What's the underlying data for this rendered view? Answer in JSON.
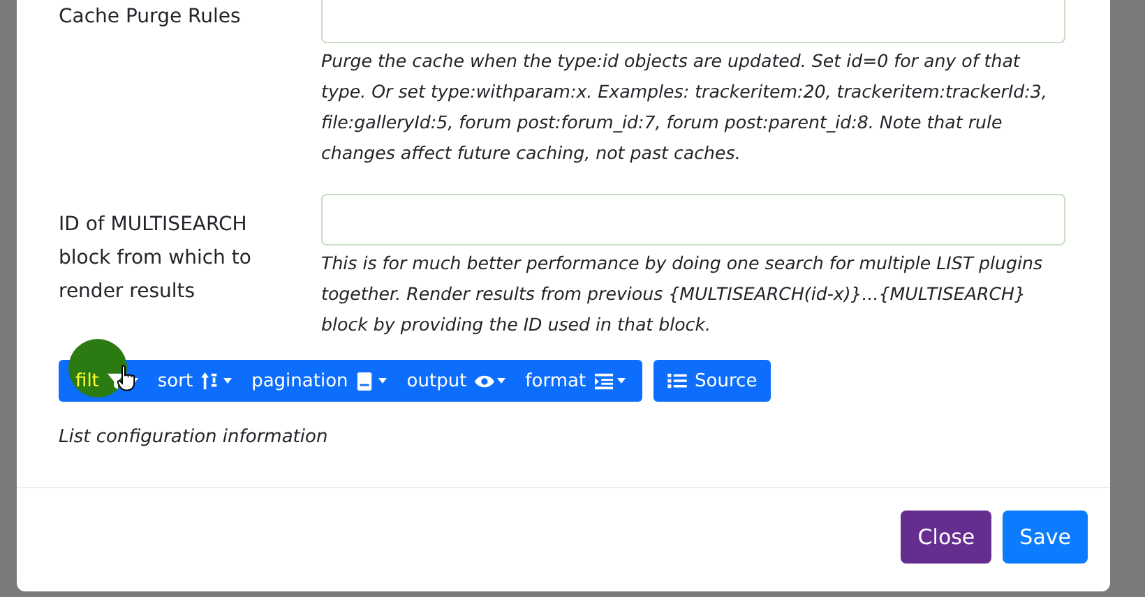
{
  "fields": [
    {
      "label": "Cache Purge Rules",
      "help": "Purge the cache when the type:id objects are updated. Set id=0 for any of that type. Or set type:withparam:x. Examples: trackeritem:20, trackeritem:trackerId:3, file:galleryId:5, forum post:forum_id:7, forum post:parent_id:8. Note that rule changes affect future caching, not past caches."
    },
    {
      "label": "ID of MULTISEARCH block from which to render results",
      "help": "This is for much better performance by doing one search for multiple LIST plugins together. Render results from previous {MULTISEARCH(id-x)}...{MULTISEARCH} block by providing the ID used in that block."
    }
  ],
  "toolbar": [
    {
      "label": "filt"
    },
    {
      "label": "sort"
    },
    {
      "label": "pagination"
    },
    {
      "label": "output"
    },
    {
      "label": "format"
    }
  ],
  "source_button": "Source",
  "info": "List configuration information",
  "footer_buttons": [
    {
      "label": "Close",
      "kind": "secondary"
    },
    {
      "label": "Save",
      "kind": "primary"
    }
  ]
}
